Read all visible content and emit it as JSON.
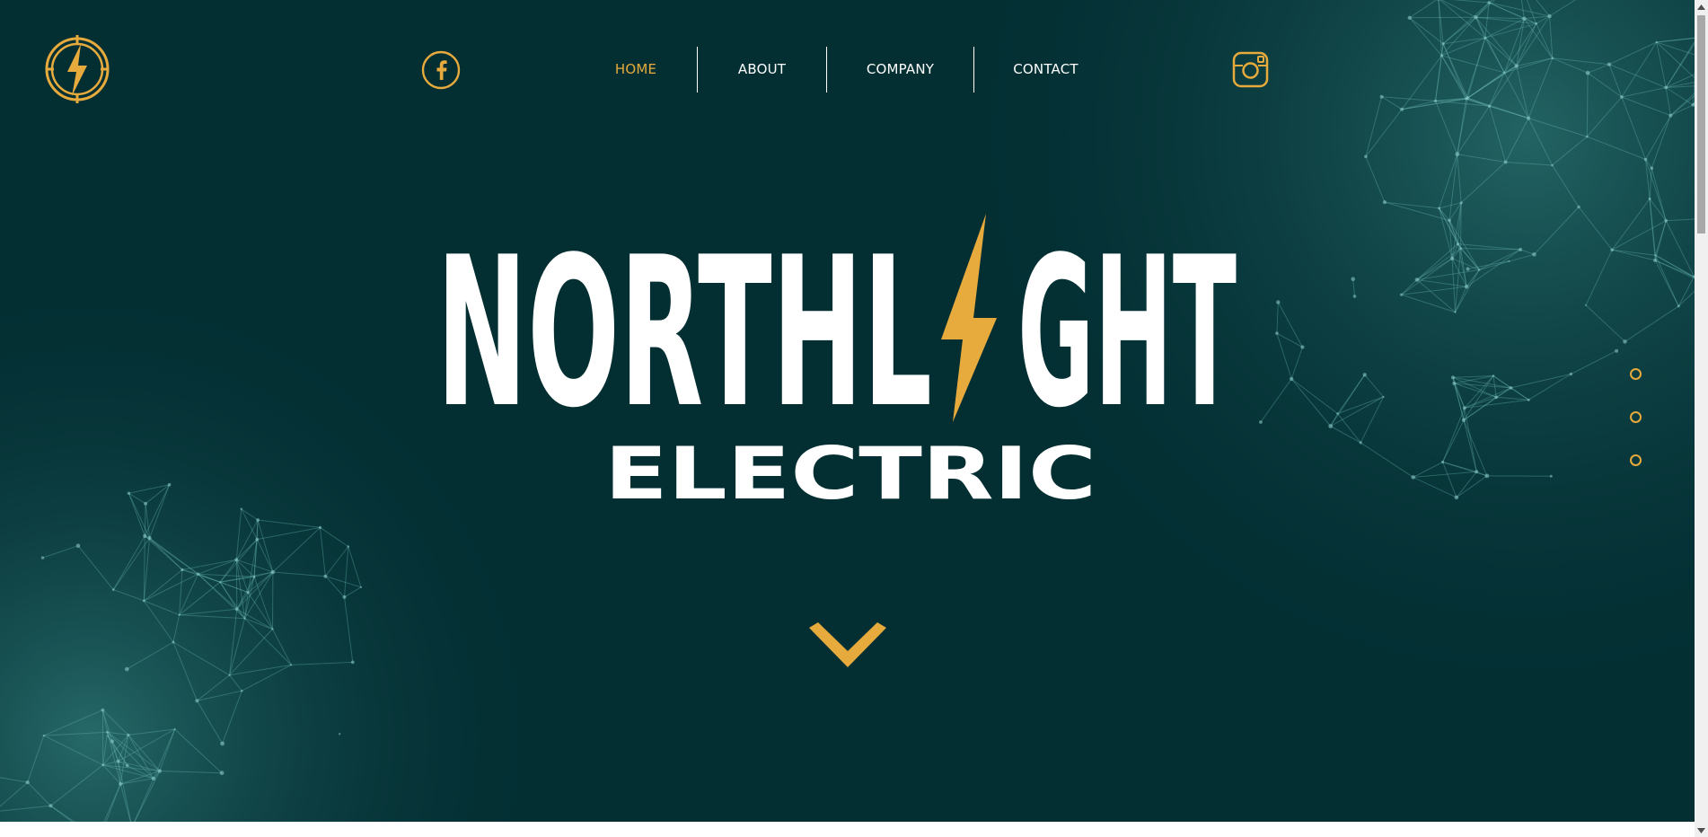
{
  "nav": {
    "items": [
      {
        "label": "HOME",
        "active": true
      },
      {
        "label": "ABOUT",
        "active": false
      },
      {
        "label": "COMPANY",
        "active": false
      },
      {
        "label": "CONTACT",
        "active": false
      }
    ]
  },
  "brand": {
    "title_left": "NORTHL",
    "title_right": "GHT",
    "subtitle": "ELECTRIC"
  },
  "social": {
    "facebook_icon": "facebook-icon",
    "instagram_icon": "instagram-icon"
  },
  "icons": {
    "logo": "lightning-bolt-logo",
    "scroll": "chevron-down-icon"
  },
  "section_dots": {
    "count": 3
  },
  "colors": {
    "background": "#032f33",
    "accent": "#e7aa3c",
    "text": "#ffffff",
    "network": "#4fa3a0"
  }
}
